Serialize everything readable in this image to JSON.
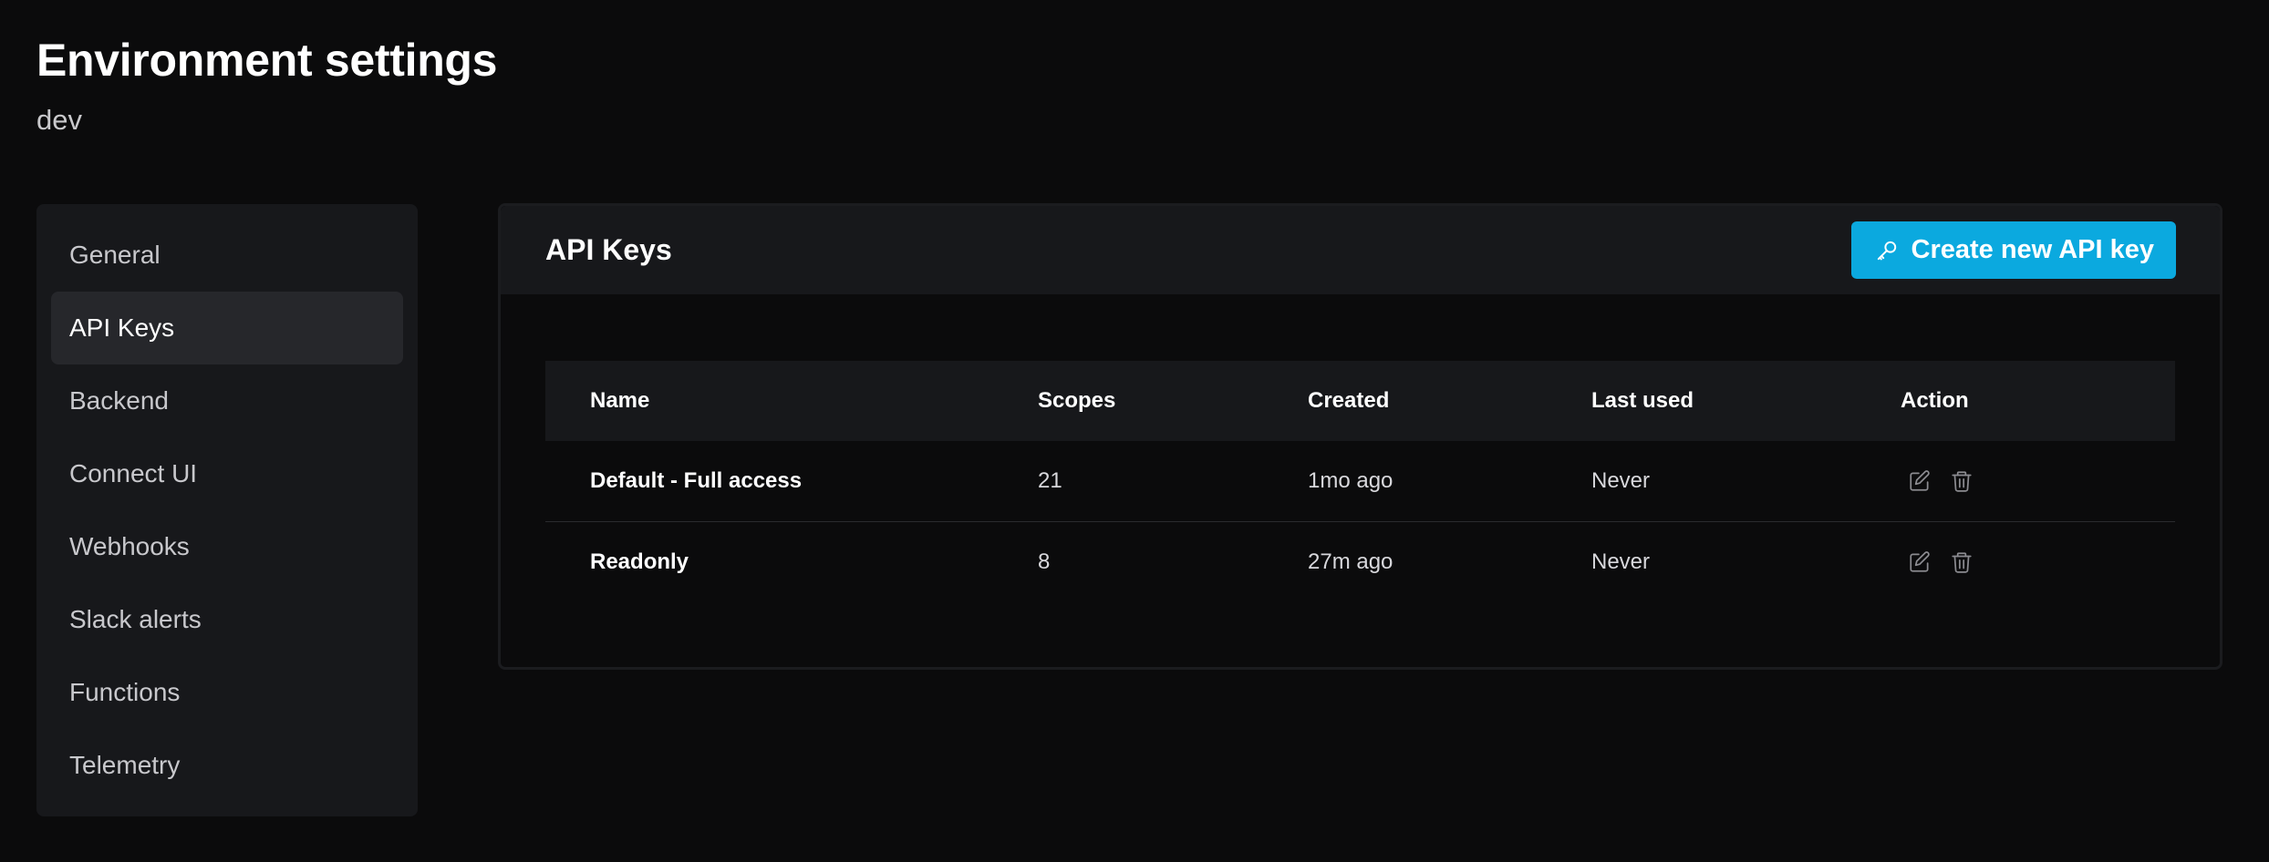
{
  "header": {
    "title": "Environment settings",
    "environment": "dev"
  },
  "sidebar": {
    "items": [
      {
        "label": "General"
      },
      {
        "label": "API Keys",
        "active": true
      },
      {
        "label": "Backend"
      },
      {
        "label": "Connect UI"
      },
      {
        "label": "Webhooks"
      },
      {
        "label": "Slack alerts"
      },
      {
        "label": "Functions"
      },
      {
        "label": "Telemetry"
      }
    ]
  },
  "panel": {
    "title": "API Keys",
    "create_button_label": "Create new API key",
    "create_button_icon": "key-icon",
    "accent_color": "#0ba9df"
  },
  "table": {
    "columns": [
      "Name",
      "Scopes",
      "Created",
      "Last used",
      "Action"
    ],
    "rows": [
      {
        "name": "Default - Full access",
        "scopes": "21",
        "created": "1mo ago",
        "last_used": "Never",
        "actions": [
          "edit-icon",
          "trash-icon"
        ]
      },
      {
        "name": "Readonly",
        "scopes": "8",
        "created": "27m ago",
        "last_used": "Never",
        "actions": [
          "edit-icon",
          "trash-icon"
        ]
      }
    ]
  }
}
